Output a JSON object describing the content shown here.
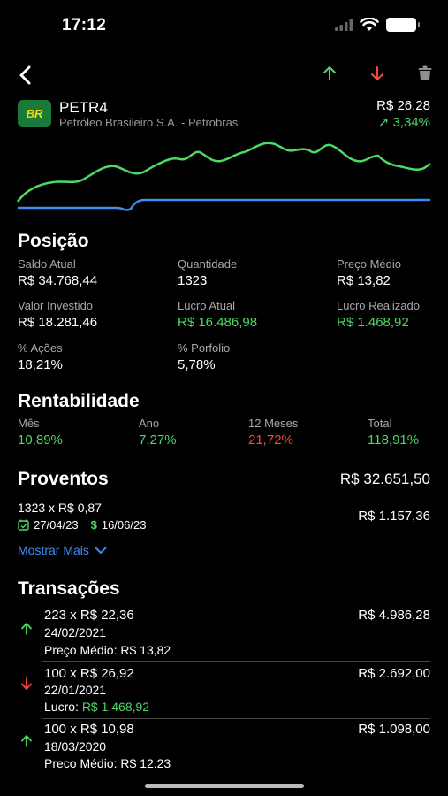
{
  "status": {
    "time": "17:12"
  },
  "asset": {
    "ticker": "PETR4",
    "logo_text": "BR",
    "company": "Petróleo Brasileiro S.A. - Petrobras",
    "price": "R$ 26,28",
    "change": "3,34%"
  },
  "colors": {
    "green": "#4cd964",
    "red": "#ff453a",
    "blue": "#3d8ef0",
    "background": "#000000"
  },
  "icons": {
    "back": "chevron-left-icon",
    "buy": "arrow-up-icon",
    "sell": "arrow-down-icon",
    "delete": "trash-icon"
  },
  "posicao": {
    "title": "Posição",
    "items": [
      {
        "label": "Saldo Atual",
        "value": "R$ 34.768,44"
      },
      {
        "label": "Quantidade",
        "value": "1323"
      },
      {
        "label": "Preço Médio",
        "value": "R$ 13,82"
      },
      {
        "label": "Valor Investido",
        "value": "R$ 18.281,46"
      },
      {
        "label": "Lucro Atual",
        "value": "R$ 16.486,98"
      },
      {
        "label": "Lucro Realizado",
        "value": "R$ 1.468,92"
      },
      {
        "label": "% Ações",
        "value": "18,21%"
      },
      {
        "label": "% Porfolio",
        "value": "5,78%"
      }
    ]
  },
  "rentabilidade": {
    "title": "Rentabilidade",
    "items": [
      {
        "label": "Mês",
        "value": "10,89%"
      },
      {
        "label": "Ano",
        "value": "7,27%"
      },
      {
        "label": "12 Meses",
        "value": "21,72%"
      },
      {
        "label": "Total",
        "value": "118,91%"
      }
    ]
  },
  "proventos": {
    "title": "Proventos",
    "total": "R$ 32.651,50",
    "item": {
      "desc": "1323 x R$ 0,87",
      "date_com": "27/04/23",
      "date_pay": "16/06/23",
      "value": "R$ 1.157,36"
    },
    "show_more": "Mostrar Mais"
  },
  "transacoes": {
    "title": "Transações",
    "items": [
      {
        "type": "buy",
        "desc": "223 x R$ 22,36",
        "date": "24/02/2021",
        "extra_label": "Preço Médio:",
        "extra_value": "R$ 13,82",
        "total": "R$ 4.986,28"
      },
      {
        "type": "sell",
        "desc": "100 x R$ 26,92",
        "date": "22/01/2021",
        "extra_label": "Lucro:",
        "extra_value": "R$ 1.468,92",
        "total": "R$ 2.692,00"
      },
      {
        "type": "buy",
        "desc": "100 x R$ 10,98",
        "date": "18/03/2020",
        "extra_label": "Preco Médio:",
        "extra_value": "R$ 12.23",
        "total": "R$ 1.098,00"
      }
    ]
  }
}
